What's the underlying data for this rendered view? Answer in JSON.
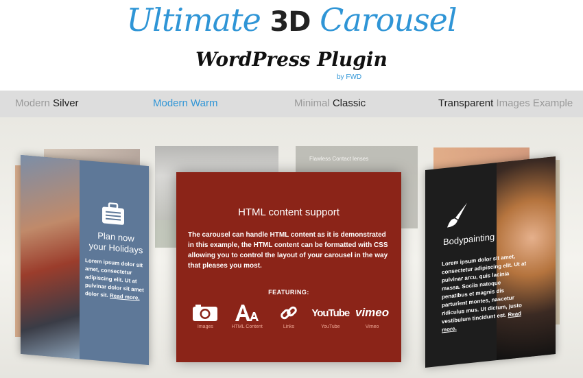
{
  "logo": {
    "title_a": "Ultimate ",
    "title_b": "3D",
    "title_c": " Carousel",
    "subtitle": "WordPress Plugin",
    "by": "by FWD"
  },
  "nav": [
    {
      "light": "Modern ",
      "strong": "Silver"
    },
    {
      "light": "Modern ",
      "strong": "Warm"
    },
    {
      "light": "Minimal ",
      "strong": "Classic"
    },
    {
      "strong": "Transparent ",
      "light": " Images Example"
    }
  ],
  "center_card": {
    "title": "HTML content support",
    "body": "The carousel can handle HTML content as it is demonstrated in this example, the HTML content can be formatted with CSS allowing you to control the layout of your carousel in the way that pleases you most.",
    "featuring": "FEATURING:",
    "features": [
      {
        "icon": "camera-icon",
        "label": "Images"
      },
      {
        "icon": "html-text-icon",
        "label": "HTML Content"
      },
      {
        "icon": "link-icon",
        "label": "Links"
      },
      {
        "icon": "youtube-logo",
        "label": "YouTube",
        "logo_text": "YouTube"
      },
      {
        "icon": "vimeo-logo",
        "label": "Vimeo",
        "logo_text": "vimeo"
      }
    ],
    "color": "#8b2418"
  },
  "left_card": {
    "icon": "suitcase-icon",
    "title_line1": "Plan now",
    "title_line2": "your Holidays",
    "body": "Lorem ipsum dolor sit amet, consectetur adipiscing elit. Ut at pulvinar dolor sit amet dolor sit.",
    "link": "Read more."
  },
  "right_card": {
    "icon": "paintbrush-icon",
    "title": "Bodypainting",
    "body": "Lorem ipsum dolor sit amet, consectetur adipiscing elit. Ut at pulvinar arcu, quis lacinia massa. Sociis natoque penatibus et magnis dis parturient montes, nascetur ridiculus mus. Ut dictum, justo vestibulum tincidunt est.",
    "link": "Read more."
  },
  "back_card": {
    "caption": "Flawless Contact lenses"
  },
  "colors": {
    "accent": "#2f95d6",
    "nav_bg": "#dddddd"
  }
}
